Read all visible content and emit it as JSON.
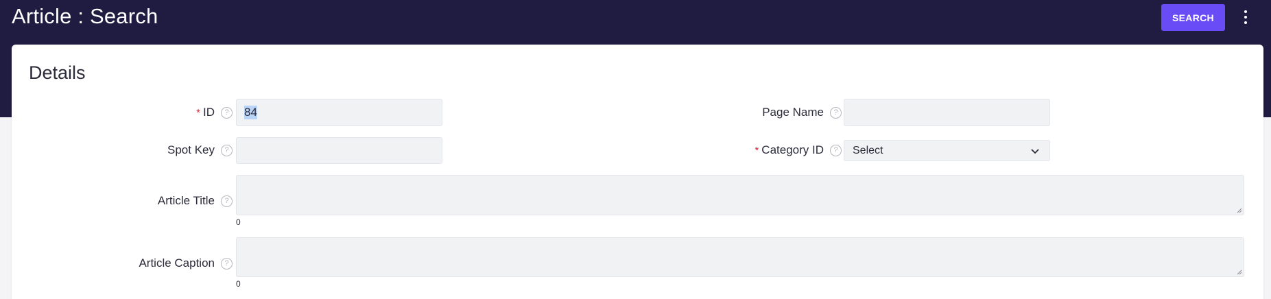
{
  "header": {
    "title": "Article : Search",
    "search_label": "SEARCH",
    "menu_icon": "kebab-vertical-icon"
  },
  "card": {
    "title": "Details"
  },
  "fields": {
    "id": {
      "label": "ID",
      "required_mark": "*",
      "value": "84",
      "help_icon": "help-circle-icon"
    },
    "page_name": {
      "label": "Page Name",
      "value": "",
      "help_icon": "help-circle-icon"
    },
    "spot_key": {
      "label": "Spot Key",
      "value": "",
      "help_icon": "help-circle-icon"
    },
    "category_id": {
      "label": "Category ID",
      "required_mark": "*",
      "selected": "Select",
      "help_icon": "help-circle-icon"
    },
    "article_title": {
      "label": "Article Title",
      "value": "",
      "char_count": "0",
      "help_icon": "help-circle-icon"
    },
    "article_caption": {
      "label": "Article Caption",
      "value": "",
      "char_count": "0",
      "help_icon": "help-circle-icon"
    }
  },
  "colors": {
    "header_bg": "#201b40",
    "accent": "#6a4cf6",
    "required": "#d6263a",
    "input_bg": "#f1f2f4"
  }
}
